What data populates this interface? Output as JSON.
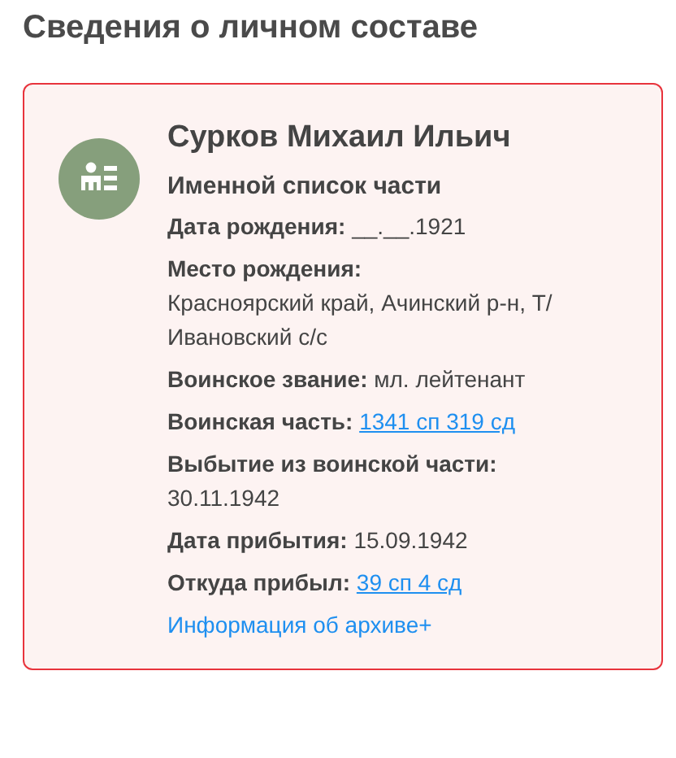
{
  "heading": "Сведения о личном составе",
  "card": {
    "name": "Сурков Михаил Ильич",
    "source": "Именной список части",
    "fields": [
      {
        "label": "Дата рождения:",
        "value": "__.__.1921",
        "kind": "text"
      },
      {
        "label": "Место рождения:",
        "value": "Красноярский край, Ачинский р-н, Т/Ивановский с/с",
        "kind": "text"
      },
      {
        "label": "Воинское звание:",
        "value": "мл. лейтенант",
        "kind": "text"
      },
      {
        "label": "Воинская часть:",
        "value": "1341 сп 319 сд",
        "kind": "link"
      },
      {
        "label": "Выбытие из воинской части:",
        "value": "30.11.1942",
        "kind": "text"
      },
      {
        "label": "Дата прибытия:",
        "value": "15.09.1942",
        "kind": "text"
      },
      {
        "label": "Откуда прибыл:",
        "value": "39 сп 4 сд",
        "kind": "link"
      }
    ],
    "archive_link": "Информация об архиве+"
  }
}
